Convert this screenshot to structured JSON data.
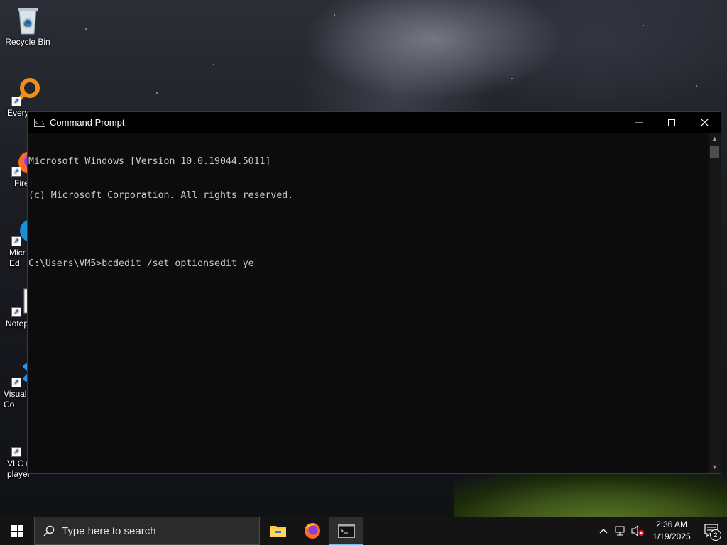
{
  "desktop": {
    "icons": [
      {
        "label": "Recycle Bin"
      },
      {
        "label": "Every"
      },
      {
        "label": "Fire"
      },
      {
        "label": "Micr\nEd"
      },
      {
        "label": "Notep"
      },
      {
        "label": "Visual\nCo"
      },
      {
        "label": "VLC m\nplayer"
      }
    ]
  },
  "window": {
    "title": "Command Prompt",
    "console_lines": [
      "Microsoft Windows [Version 10.0.19044.5011]",
      "(c) Microsoft Corporation. All rights reserved.",
      "",
      "C:\\Users\\VM5>bcdedit /set optionsedit ye"
    ]
  },
  "taskbar": {
    "search_placeholder": "Type here to search",
    "time": "2:36 AM",
    "date": "1/19/2025",
    "notification_count": "2"
  }
}
